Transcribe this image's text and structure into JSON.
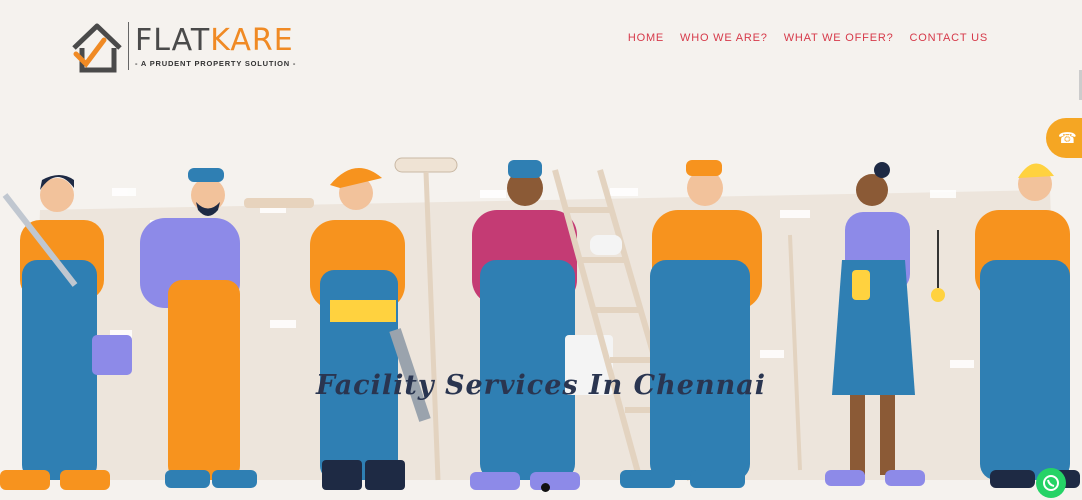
{
  "brand": {
    "name_part1": "FLAT",
    "name_part2": "KARE",
    "tagline": "- A PRUDENT PROPERTY SOLUTION -",
    "accent_color": "#f08a24"
  },
  "nav": {
    "items": [
      {
        "label": "HOME"
      },
      {
        "label": "WHO WE ARE?"
      },
      {
        "label": "WHAT WE OFFER?"
      },
      {
        "label": "CONTACT US"
      }
    ],
    "color": "#d63a4a"
  },
  "hero": {
    "caption": "Facility Services In Chennai",
    "slide_indicator": "1"
  },
  "floating": {
    "call_icon": "phone-icon",
    "whatsapp_icon": "whatsapp-icon"
  }
}
